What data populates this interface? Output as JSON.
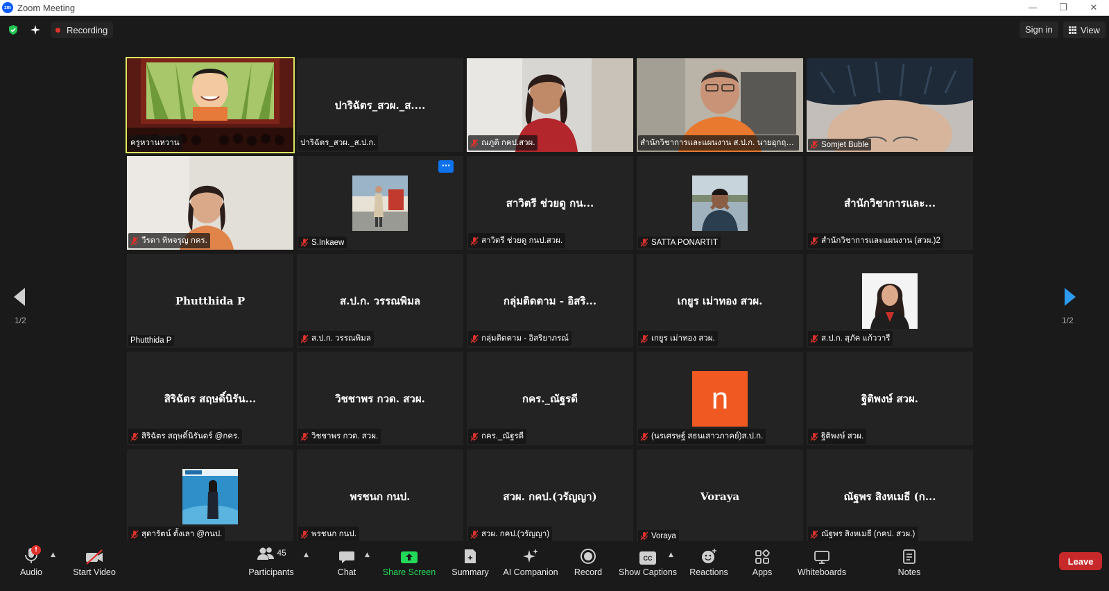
{
  "window": {
    "title": "Zoom Meeting",
    "app_icon_text": "zm"
  },
  "topbar": {
    "recording_label": "Recording",
    "sign_in_label": "Sign in",
    "view_label": "View"
  },
  "navigation": {
    "page_left": "1/2",
    "page_right": "1/2"
  },
  "tiles": [
    {
      "big_name": "",
      "label": "ครูหวานหวาน",
      "muted": false,
      "type": "video-classroom",
      "active": true
    },
    {
      "big_name": "ปาริฉัตร_สวผ._ส....",
      "label": "ปาริฉัตร_สวผ._ส.ป.ก.",
      "muted": false,
      "type": "name"
    },
    {
      "big_name": "",
      "label": "ณภูติ กคป.สวผ.",
      "muted": true,
      "type": "video-woman"
    },
    {
      "big_name": "",
      "label": "สำนักวิชาการและแผนงาน ส.ป.ก. นายอุกฤษฏ์...",
      "muted": false,
      "type": "video-man"
    },
    {
      "big_name": "",
      "label": "Somjet Buble",
      "muted": true,
      "type": "video-hair"
    },
    {
      "big_name": "",
      "label": "วีรดา ทิพจรุญ กคร.",
      "muted": true,
      "type": "video-woman2"
    },
    {
      "big_name": "",
      "label": "S.Inkaew",
      "muted": true,
      "type": "photo-standing",
      "more_button": "···"
    },
    {
      "big_name": "สาวิตรี ช่วยดู  กน...",
      "label": "สาวิตรี ช่วยดู  กนป.สวผ.",
      "muted": true,
      "type": "name"
    },
    {
      "big_name": "",
      "label": "SATTA PONARTIT",
      "muted": true,
      "type": "photo-man"
    },
    {
      "big_name": "สำนักวิชาการและ...",
      "label": "สำนักวิชาการและแผนงาน (สวผ.)2",
      "muted": true,
      "type": "name"
    },
    {
      "big_name": "Phutthida P",
      "label": "Phutthida P",
      "muted": false,
      "type": "name"
    },
    {
      "big_name": "ส.ป.ก. วรรณพิมล",
      "label": "ส.ป.ก. วรรณพิมล",
      "muted": true,
      "type": "name"
    },
    {
      "big_name": "กลุ่มติดตาม - อิสริ...",
      "label": "กลุ่มติดตาม - อิสริยาภรณ์",
      "muted": true,
      "type": "name"
    },
    {
      "big_name": "เกยูร เม่าทอง สวผ.",
      "label": "เกยูร เม่าทอง สวผ.",
      "muted": true,
      "type": "name"
    },
    {
      "big_name": "",
      "label": "ส.ป.ก. สุภัค แก้ววารี",
      "muted": true,
      "type": "photo-woman-portrait"
    },
    {
      "big_name": "สิริฉัตร สฤษดิ์นิรัน...",
      "label": "สิริฉัตร สฤษดิ์นิรันดร์ @กคร.",
      "muted": true,
      "type": "name"
    },
    {
      "big_name": "วิชชาพร กวด. สวผ.",
      "label": "วิชชาพร กวด. สวผ.",
      "muted": true,
      "type": "name"
    },
    {
      "big_name": "กคร._ณัฐรดี",
      "label": "กคร._ณัฐรดี",
      "muted": true,
      "type": "name"
    },
    {
      "big_name": "",
      "label": "(นรเศรษฐ์ สธนเสาวภาคย์)ส.ป.ก.",
      "muted": true,
      "type": "letter",
      "letter": "n"
    },
    {
      "big_name": "ฐิติพงษ์ สวผ.",
      "label": "ฐิติพงษ์ สวผ.",
      "muted": true,
      "type": "name"
    },
    {
      "big_name": "",
      "label": "สุดารัตน์ ตั้งเลา @กนป.",
      "muted": true,
      "type": "photo-blue"
    },
    {
      "big_name": "พรชนก กนป.",
      "label": "พรชนก กนป.",
      "muted": true,
      "type": "name"
    },
    {
      "big_name": "สวผ. กคป.(วรัญญา)",
      "label": "สวผ. กคป.(วรัญญา)",
      "muted": true,
      "type": "name"
    },
    {
      "big_name": "Voraya",
      "label": "Voraya",
      "muted": true,
      "type": "name"
    },
    {
      "big_name": "ณัฐพร สิงหเมธี (ก...",
      "label": "ณัฐพร สิงหเมธี (กคป. สวผ.)",
      "muted": true,
      "type": "name"
    }
  ],
  "toolbar": {
    "audio_label": "Audio",
    "audio_badge": "!",
    "start_video_label": "Start Video",
    "participants_label": "Participants",
    "participants_count": "45",
    "chat_label": "Chat",
    "share_screen_label": "Share Screen",
    "summary_label": "Summary",
    "ai_companion_label": "AI Companion",
    "record_label": "Record",
    "show_captions_label": "Show Captions",
    "captions_icon_text": "CC",
    "reactions_label": "Reactions",
    "apps_label": "Apps",
    "whiteboards_label": "Whiteboards",
    "notes_label": "Notes",
    "leave_label": "Leave"
  },
  "colors": {
    "background": "#1a1a1a",
    "tile": "#232323",
    "active_speaker": "#dbe85e",
    "share_green": "#23d959",
    "leave_red": "#c7292a",
    "accent_blue": "#0e72ed",
    "letter_avatar": "#f05a22"
  }
}
